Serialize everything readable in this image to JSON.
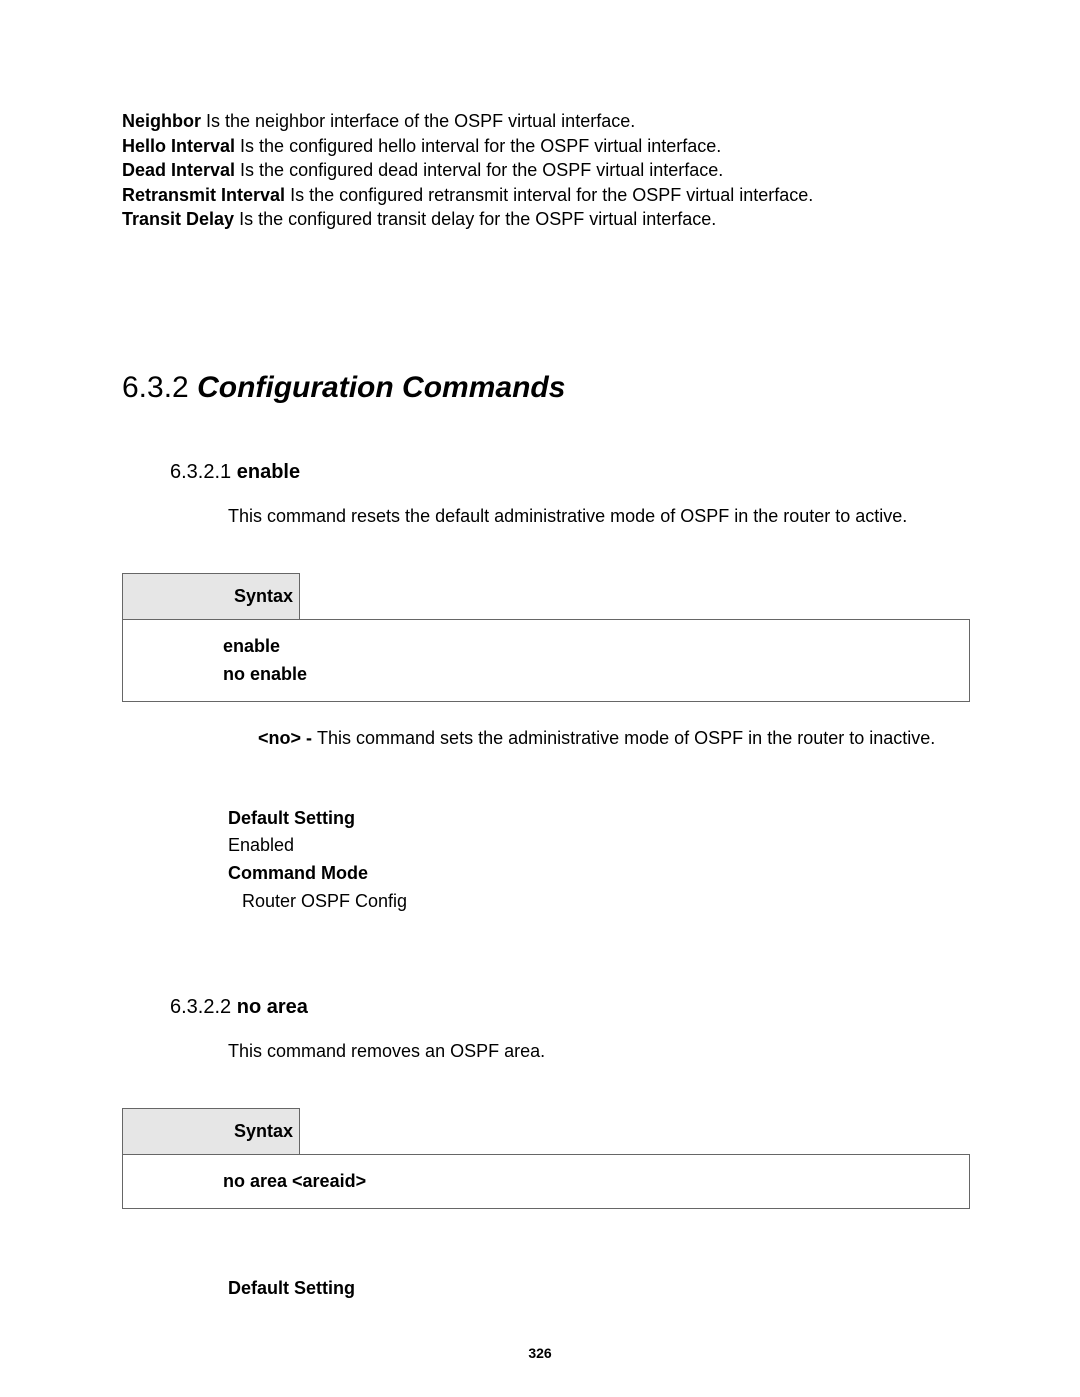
{
  "definitions": [
    {
      "term": "Neighbor",
      "text": " Is the neighbor interface of the OSPF virtual interface."
    },
    {
      "term": "Hello Interval",
      "text": " Is the configured hello interval for the OSPF virtual interface."
    },
    {
      "term": "Dead Interval",
      "text": " Is the configured dead interval for the OSPF virtual interface."
    },
    {
      "term": "Retransmit Interval",
      "text": " Is the configured retransmit interval for the OSPF virtual interface."
    },
    {
      "term": "Transit Delay",
      "text": " Is the configured transit delay for the OSPF virtual interface."
    }
  ],
  "section": {
    "number": "6.3.2",
    "title": "Configuration Commands"
  },
  "sub1": {
    "number": "6.3.2.1",
    "title": "enable",
    "desc": "This command resets the default administrative mode of OSPF in the router to active.",
    "syntax_label": "Syntax",
    "syntax_lines": [
      "enable",
      "no enable"
    ],
    "note_tag": "<no> - ",
    "note_text": "This command sets the administrative mode of OSPF in the router to inactive.",
    "default_setting_label": "Default Setting",
    "default_setting_value": "Enabled",
    "command_mode_label": "Command Mode",
    "command_mode_value": "Router OSPF Config"
  },
  "sub2": {
    "number": "6.3.2.2",
    "title": "no area",
    "desc": "This command removes an OSPF area.",
    "syntax_label": "Syntax",
    "syntax_lines": [
      "no area <areaid>"
    ],
    "default_setting_label": "Default Setting"
  },
  "page_number": "326"
}
